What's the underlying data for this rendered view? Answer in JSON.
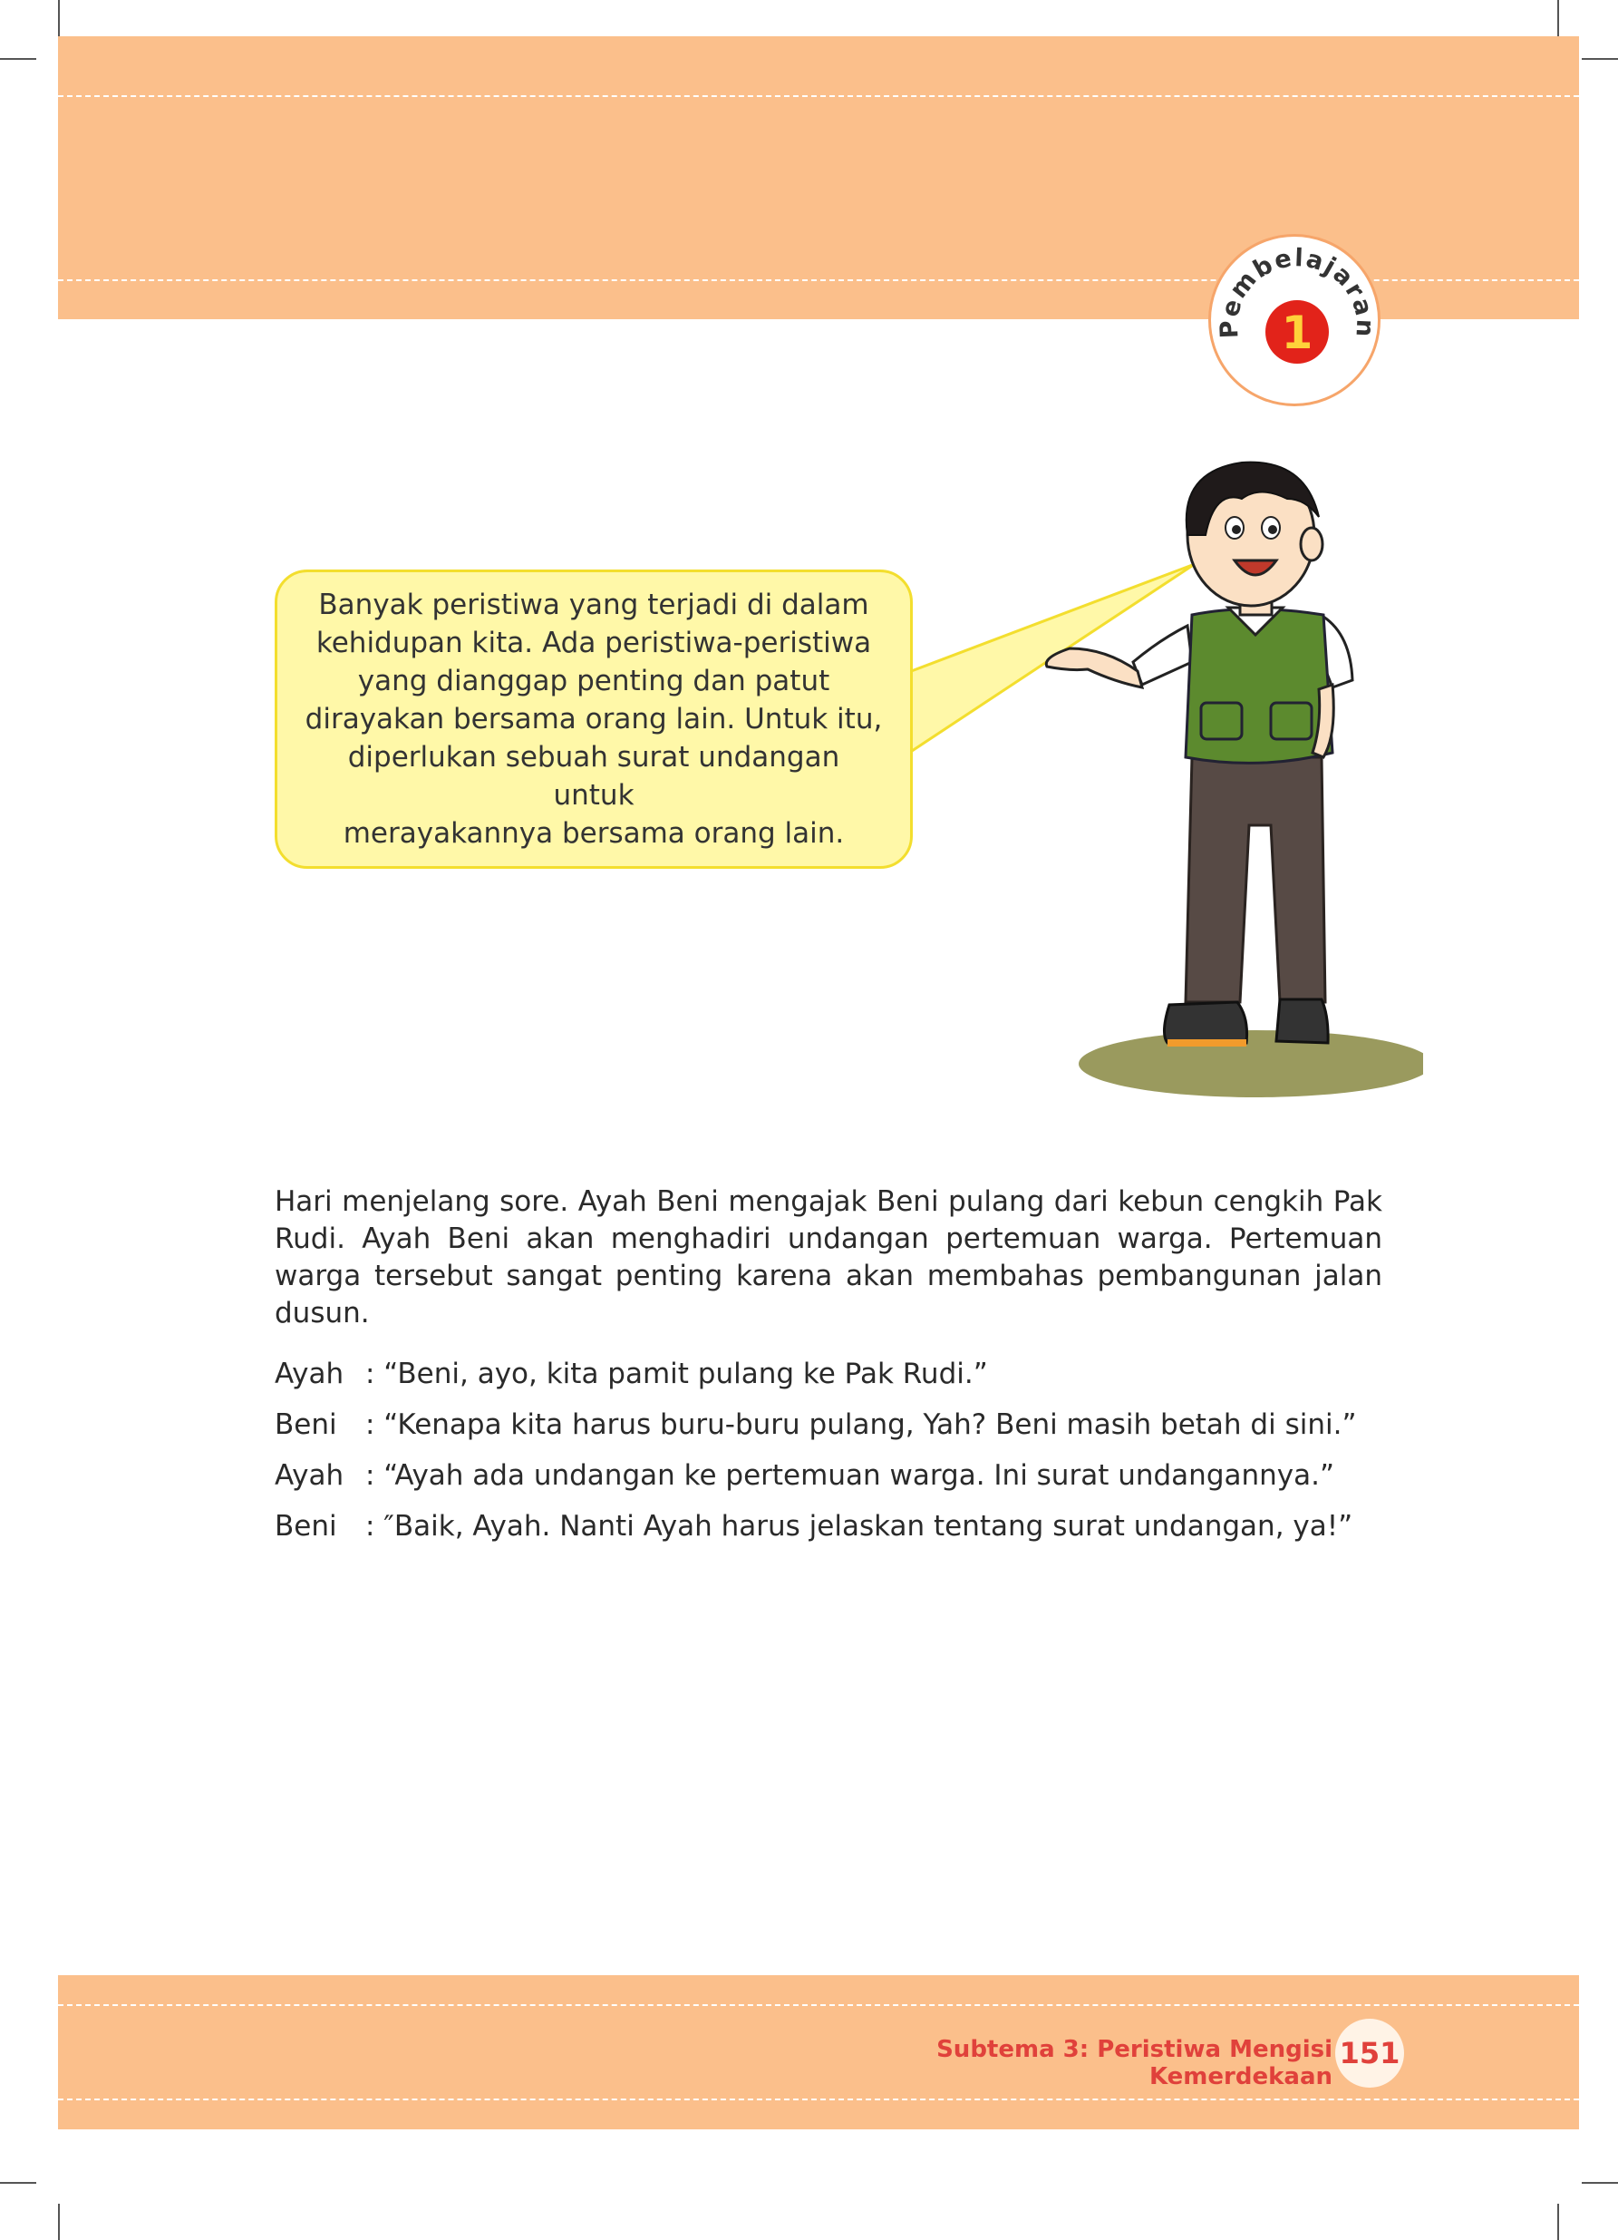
{
  "lesson_badge": {
    "label": "Pembelajaran",
    "number": "1"
  },
  "speech_bubble": {
    "text": "Banyak peristiwa yang terjadi di dalam\nkehidupan kita.  Ada peristiwa-peristiwa\nyang dianggap penting dan patut\ndirayakan bersama orang lain.  Untuk itu,\ndiperlukan sebuah surat undangan untuk\nmerayakannya bersama orang lain."
  },
  "story": {
    "paragraph": "Hari menjelang sore. Ayah Beni mengajak Beni pulang dari kebun cengkih Pak Rudi. Ayah Beni akan menghadiri undangan pertemuan warga. Pertemuan warga tersebut sangat penting karena akan membahas pembangunan jalan dusun.",
    "dialogue": [
      {
        "speaker": "Ayah",
        "line": ": “Beni, ayo, kita pamit pulang ke Pak Rudi.”"
      },
      {
        "speaker": "Beni",
        "line": ": “Kenapa kita harus buru-buru pulang, Yah? Beni masih betah di sini.”"
      },
      {
        "speaker": "Ayah",
        "line": ": “Ayah ada undangan ke pertemuan warga.  Ini surat undangannya.”"
      },
      {
        "speaker": "Beni",
        "line": ": ″Baik, Ayah.  Nanti Ayah harus jelaskan tentang surat undangan, ya!”"
      }
    ]
  },
  "footer": {
    "subtheme": "Subtema 3: Peristiwa Mengisi Kemerdekaan",
    "page_number": "151"
  },
  "colors": {
    "band": "#fbbf8b",
    "bubble": "#fff8a8",
    "accent_red": "#e0413b"
  }
}
